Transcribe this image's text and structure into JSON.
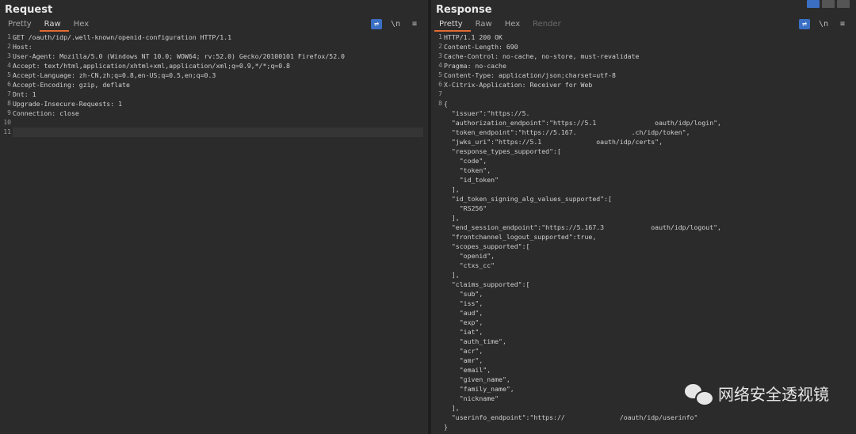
{
  "request": {
    "title": "Request",
    "tabs": [
      "Pretty",
      "Raw",
      "Hex"
    ],
    "active_tab": "Raw",
    "tools": [
      "wrap-icon",
      "\\n",
      "menu-icon"
    ],
    "lines": [
      "GET /oauth/idp/.well-known/openid-configuration HTTP/1.1",
      "Host: ",
      "User-Agent: Mozilla/5.0 (Windows NT 10.0; WOW64; rv:52.0) Gecko/20100101 Firefox/52.0",
      "Accept: text/html,application/xhtml+xml,application/xml;q=0.9,*/*;q=0.8",
      "Accept-Language: zh-CN,zh;q=0.8,en-US;q=0.5,en;q=0.3",
      "Accept-Encoding: gzip, deflate",
      "Dnt: 1",
      "Upgrade-Insecure-Requests: 1",
      "Connection: close",
      "",
      ""
    ]
  },
  "response": {
    "title": "Response",
    "tabs": [
      "Pretty",
      "Raw",
      "Hex",
      "Render"
    ],
    "active_tab": "Pretty",
    "tools": [
      "wrap-icon",
      "\\n",
      "menu-icon"
    ],
    "lines": [
      "HTTP/1.1 200 OK",
      "Content-Length: 690",
      "Cache-Control: no-cache, no-store, must-revalidate",
      "Pragma: no-cache",
      "Content-Type: application/json;charset=utf-8",
      "X-Citrix-Application: Receiver for Web",
      "",
      "{",
      "  \"issuer\":\"https://5.",
      "  \"authorization_endpoint\":\"https://5.1               oauth/idp/login\",",
      "  \"token_endpoint\":\"https://5.167.              .ch/idp/token\",",
      "  \"jwks_uri\":\"https://5.1              oauth/idp/certs\",",
      "  \"response_types_supported\":[",
      "    \"code\",",
      "    \"token\",",
      "    \"id_token\"",
      "  ],",
      "  \"id_token_signing_alg_values_supported\":[",
      "    \"RS256\"",
      "  ],",
      "  \"end_session_endpoint\":\"https://5.167.3            oauth/idp/logout\",",
      "  \"frontchannel_logout_supported\":true,",
      "  \"scopes_supported\":[",
      "    \"openid\",",
      "    \"ctxs_cc\"",
      "  ],",
      "  \"claims_supported\":[",
      "    \"sub\",",
      "    \"iss\",",
      "    \"aud\",",
      "    \"exp\",",
      "    \"iat\",",
      "    \"auth_time\",",
      "    \"acr\",",
      "    \"amr\",",
      "    \"email\",",
      "    \"given_name\",",
      "    \"family_name\",",
      "    \"nickname\"",
      "  ],",
      "  \"userinfo_endpoint\":\"https://              /oauth/idp/userinfo\"",
      "}"
    ],
    "gutter": [
      "1",
      "2",
      "3",
      "4",
      "5",
      "6",
      "7",
      "8"
    ]
  },
  "watermark": "网络安全透视镜",
  "colors": {
    "background": "#2b2b2b",
    "tab_active": "#e26a33",
    "accent": "#3a6fc4"
  }
}
